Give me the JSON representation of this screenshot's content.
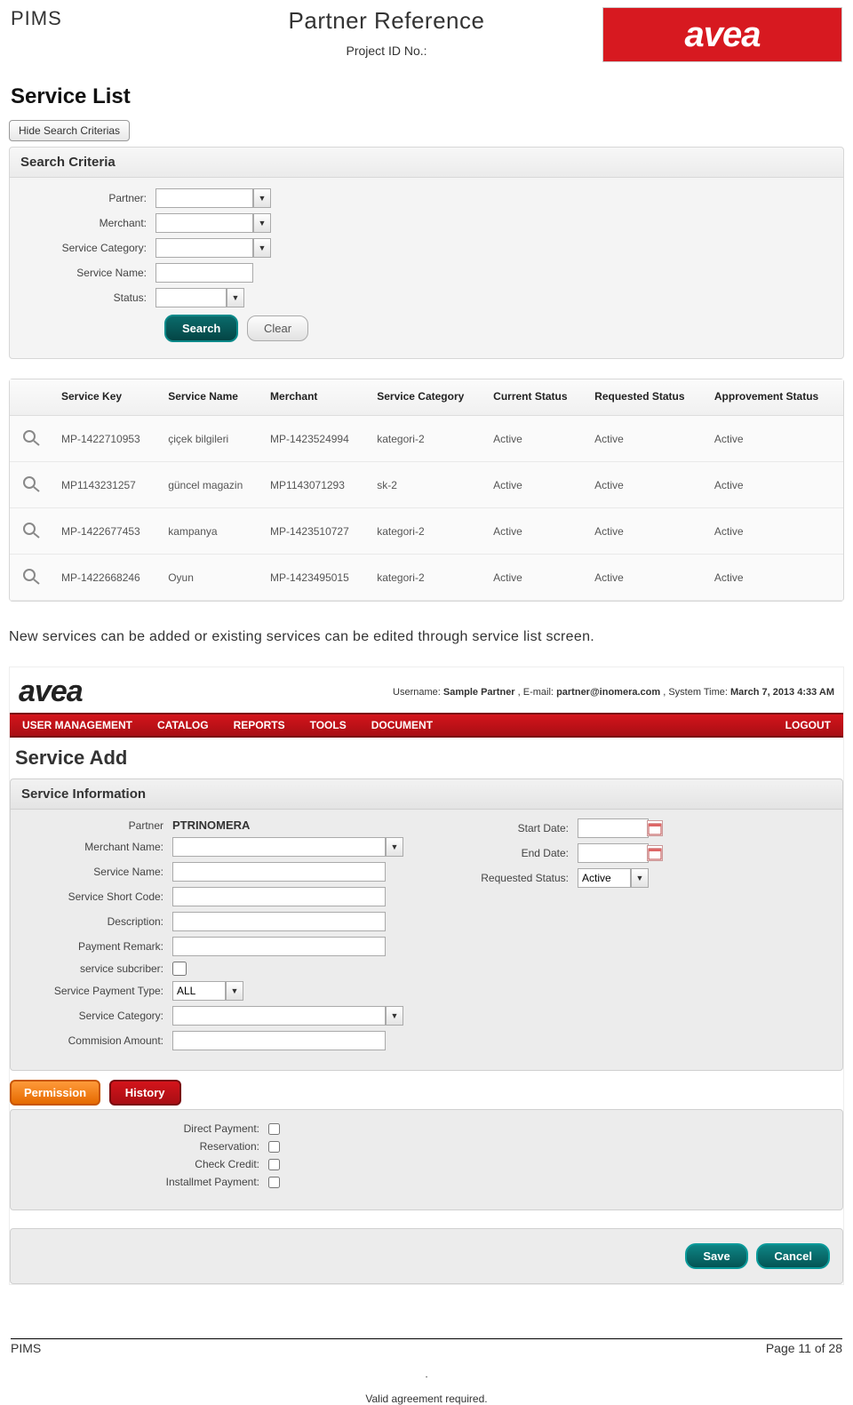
{
  "doc": {
    "pims": "PIMS",
    "title": "Partner Reference",
    "project_id_label": "Project ID No.:",
    "logo": "avea",
    "narrative": "New services can be added or existing services can be edited through service list screen.",
    "footer_pims": "PIMS",
    "footer_page": "Page 11 of 28",
    "footer_dot": ".",
    "footer_valid": "Valid agreement required."
  },
  "s1": {
    "page_title": "Service List",
    "hide_btn": "Hide Search Criterias",
    "panel_title": "Search Criteria",
    "labels": {
      "partner": "Partner:",
      "merchant": "Merchant:",
      "category": "Service Category:",
      "name": "Service Name:",
      "status": "Status:"
    },
    "search_btn": "Search",
    "clear_btn": "Clear",
    "cols": [
      "Service Key",
      "Service Name",
      "Merchant",
      "Service Category",
      "Current Status",
      "Requested Status",
      "Approvement Status"
    ],
    "rows": [
      {
        "key": "MP-1422710953",
        "name": "çiçek bilgileri",
        "merchant": "MP-1423524994",
        "cat": "kategori-2",
        "cs": "Active",
        "rs": "Active",
        "as": "Active"
      },
      {
        "key": "MP1143231257",
        "name": "güncel magazin",
        "merchant": "MP1143071293",
        "cat": "sk-2",
        "cs": "Active",
        "rs": "Active",
        "as": "Active"
      },
      {
        "key": "MP-1422677453",
        "name": "kampanya",
        "merchant": "MP-1423510727",
        "cat": "kategori-2",
        "cs": "Active",
        "rs": "Active",
        "as": "Active"
      },
      {
        "key": "MP-1422668246",
        "name": "Oyun",
        "merchant": "MP-1423495015",
        "cat": "kategori-2",
        "cs": "Active",
        "rs": "Active",
        "as": "Active"
      }
    ]
  },
  "s2": {
    "userinfo": {
      "u_label": "Username: ",
      "u_val": "Sample Partner",
      "e_label": " , E-mail: ",
      "e_val": "partner@inomera.com",
      "t_label": " , System Time: ",
      "t_val": "March 7, 2013 4:33 AM"
    },
    "nav": [
      "USER MANAGEMENT",
      "CATALOG",
      "REPORTS",
      "TOOLS",
      "DOCUMENT"
    ],
    "logout": "LOGOUT",
    "page_title": "Service Add",
    "panel_title": "Service Information",
    "left_labels": {
      "partner": "Partner",
      "partner_val": "PTRINOMERA",
      "merchant": "Merchant Name:",
      "sname": "Service Name:",
      "shortcode": "Service Short Code:",
      "desc": "Description:",
      "premark": "Payment Remark:",
      "subscriber": "service subcriber:",
      "ptype": "Service Payment Type:",
      "ptype_val": "ALL",
      "scat": "Service Category:",
      "comm": "Commision Amount:"
    },
    "right_labels": {
      "start": "Start Date:",
      "end": "End Date:",
      "reqstat": "Requested Status:",
      "reqstat_val": "Active"
    },
    "tabs": {
      "permission": "Permission",
      "history": "History"
    },
    "payments": {
      "direct": "Direct Payment:",
      "reserve": "Reservation:",
      "check": "Check Credit:",
      "install": "Installmet Payment:"
    },
    "save": "Save",
    "cancel": "Cancel"
  }
}
